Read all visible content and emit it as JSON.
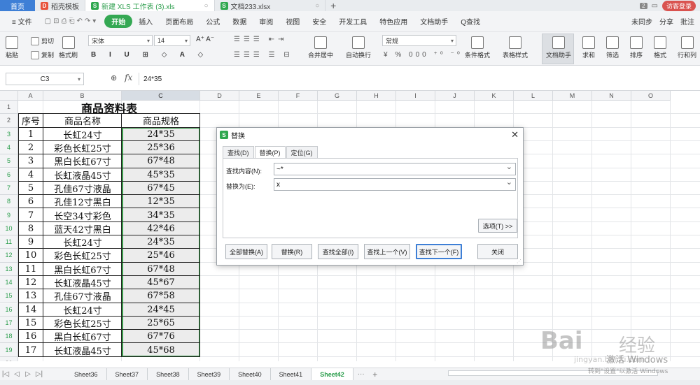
{
  "titlebar": {
    "home": "首页",
    "tabs": [
      {
        "label": "稻壳模板",
        "badge": "D",
        "color": "#e8533a"
      },
      {
        "label": "新建 XLS 工作表 (3).xls",
        "badge": "S",
        "color": "#2fa84f"
      },
      {
        "label": "文档233.xlsx",
        "badge": "S",
        "color": "#2fa84f"
      }
    ],
    "add": "+",
    "window_count": "2",
    "login": "访客登录"
  },
  "menubar": {
    "file": "≡ 文件",
    "items": [
      "开始",
      "插入",
      "页面布局",
      "公式",
      "数据",
      "审阅",
      "视图",
      "安全",
      "开发工具",
      "特色应用",
      "文档助手",
      "Q查找"
    ],
    "right": [
      "未同步",
      "分享",
      "批注"
    ]
  },
  "ribbon": {
    "paste": "粘贴",
    "cut": "剪切",
    "copy": "复制",
    "format_painter": "格式刷",
    "font": "宋体",
    "size": "14",
    "merge": "合并居中",
    "wrap": "自动换行",
    "number_format": "常规",
    "cond_format": "条件格式",
    "table_style": "表格样式",
    "doc_helper": "文档助手",
    "sum": "求和",
    "filter": "筛选",
    "sort": "排序",
    "format": "格式",
    "rowcol": "行和列"
  },
  "formula_bar": {
    "cell_ref": "C3",
    "fx": "fx",
    "formula": "24*35"
  },
  "columns": [
    "A",
    "B",
    "C",
    "D",
    "E",
    "F",
    "G",
    "H",
    "I",
    "J",
    "K",
    "L",
    "M",
    "N",
    "O"
  ],
  "rows": [
    "1",
    "2",
    "3",
    "4",
    "5",
    "6",
    "7",
    "8",
    "9",
    "10",
    "11",
    "12",
    "13",
    "14",
    "15",
    "16",
    "17",
    "18",
    "19",
    "20"
  ],
  "table": {
    "title": "商品资料表",
    "headers": [
      "序号",
      "商品名称",
      "商品规格"
    ],
    "data": [
      [
        "1",
        "长虹24寸",
        "24*35"
      ],
      [
        "2",
        "彩色长虹25寸",
        "25*36"
      ],
      [
        "3",
        "黑白长虹67寸",
        "67*48"
      ],
      [
        "4",
        "长虹液晶45寸",
        "45*35"
      ],
      [
        "5",
        "孔佳67寸液晶",
        "67*45"
      ],
      [
        "6",
        "孔佳12寸黑白",
        "12*35"
      ],
      [
        "7",
        "长空34寸彩色",
        "34*35"
      ],
      [
        "8",
        "蓝天42寸黑白",
        "42*46"
      ],
      [
        "9",
        "长虹24寸",
        "24*35"
      ],
      [
        "10",
        "彩色长虹25寸",
        "25*46"
      ],
      [
        "11",
        "黑白长虹67寸",
        "67*48"
      ],
      [
        "12",
        "长虹液晶45寸",
        "45*67"
      ],
      [
        "13",
        "孔佳67寸液晶",
        "67*58"
      ],
      [
        "14",
        "长虹24寸",
        "24*45"
      ],
      [
        "15",
        "彩色长虹25寸",
        "25*65"
      ],
      [
        "16",
        "黑白长虹67寸",
        "67*76"
      ],
      [
        "17",
        "长虹液晶45寸",
        "45*68"
      ]
    ]
  },
  "sheets": [
    "Sheet36",
    "Sheet37",
    "Sheet38",
    "Sheet39",
    "Sheet40",
    "Sheet41",
    "Sheet42"
  ],
  "active_sheet": "Sheet42",
  "dialog": {
    "title": "替换",
    "tabs": [
      "查找(D)",
      "替换(P)",
      "定位(G)"
    ],
    "find_label": "查找内容(N):",
    "find_value": "~*",
    "replace_label": "替换为(E):",
    "replace_value": "x",
    "options": "选项(T) >>",
    "buttons": [
      "全部替换(A)",
      "替换(R)",
      "查找全部(I)",
      "查找上一个(V)",
      "查找下一个(F)",
      "关闭"
    ]
  },
  "watermark": {
    "baidu": "Bai",
    "jingyan": "经验",
    "url": "jingyan.baidu.com",
    "activate": "激活 Windows",
    "activate_sub": "转到\"设置\"以激活 Windows"
  }
}
